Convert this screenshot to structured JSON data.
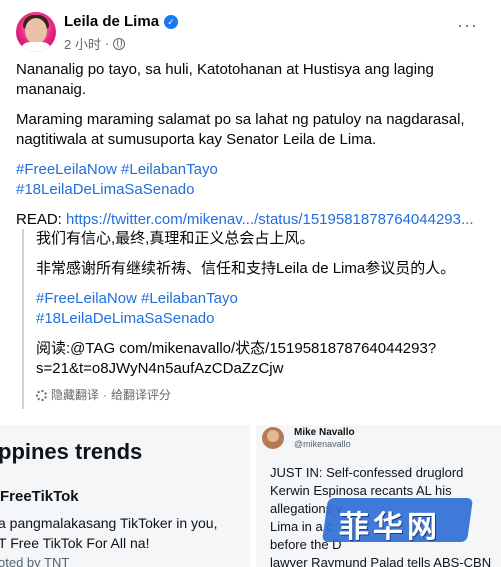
{
  "post": {
    "author": "Leila de Lima",
    "timestamp": "2 小时",
    "paragraphs": [
      "Nananalig po tayo, sa huli, Katotohanan at Hustisya ang laging mananaig.",
      "Maraming maraming salamat po sa lahat ng patuloy na nagdarasal, nagtitiwala at sumusuporta kay Senator Leila de Lima."
    ],
    "hashtags_line1": "#FreeLeilaNow #LeilabanTayo",
    "hashtags_line2": "#18LeilaDeLimaSaSenado",
    "read_label": "READ: ",
    "read_link": "https://twitter.com/mikenav.../status/1519581878764044293..."
  },
  "translation": {
    "line1": "我们有信心,最终,真理和正义总会占上风。",
    "line2": "非常感谢所有继续祈祷、信任和支持Leila de Lima参议员的人。",
    "hashtags_line1": "#FreeLeilaNow #LeilabanTayo",
    "hashtags_line2": "#18LeilaDeLimaSaSenado",
    "read_line1": "阅读:@TAG com/mikenavallo/状态/1519581878764044293?",
    "read_line2": "s=21&t=o8JWyN4n5aufAzCDaZzCjw",
    "hide_label": "隐藏翻译",
    "separator": " · ",
    "rate_label": "给翻译评分"
  },
  "trends_panel": {
    "title": "ppines trends",
    "trend_name": "FreeTikTok",
    "desc_line1": "a pangmalakasang TikToker in you,",
    "desc_line2": "T Free TikTok For All na!",
    "promoted": "oted by TNT"
  },
  "tweet_panel": {
    "name": "Mike Navallo",
    "handle": "@mikenavallo",
    "text_lines": [
      "JUST IN: Self-confessed druglord",
      "Kerwin Espinosa recants AL his",
      "allegations v",
      "Lima in a c",
      "before the D",
      "lawyer Raymund Palad tells ABS-CBN"
    ]
  },
  "watermark": {
    "text": "菲华网"
  },
  "colors": {
    "link": "#216fdb",
    "verified": "#1877f2",
    "watermark": "#2f6fd6"
  }
}
